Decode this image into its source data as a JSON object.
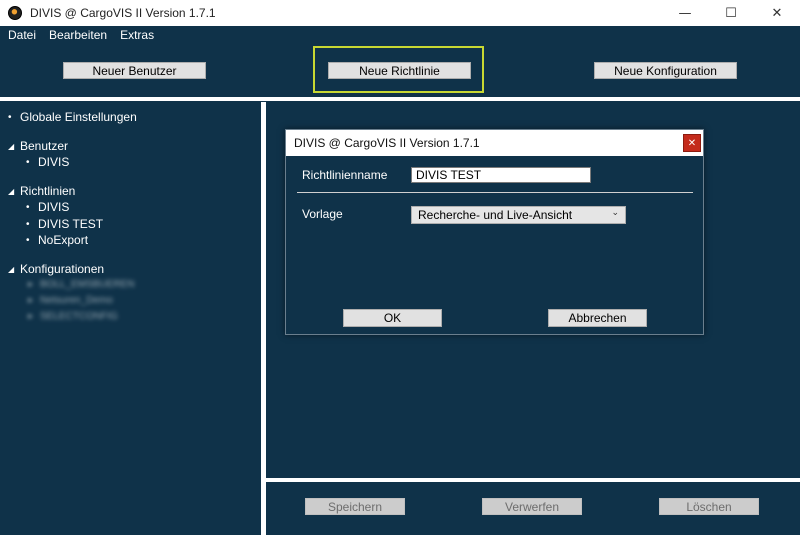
{
  "window": {
    "title": "DIVIS @ CargoVIS II Version 1.7.1",
    "minimize_glyph": "—",
    "maximize_glyph": "☐",
    "close_glyph": "✕"
  },
  "menu": {
    "items": [
      "Datei",
      "Bearbeiten",
      "Extras"
    ]
  },
  "toolbar": {
    "new_user": "Neuer Benutzer",
    "new_policy": "Neue Richtlinie",
    "new_config": "Neue Konfiguration"
  },
  "tree": {
    "global": "Globale Einstellungen",
    "users_header": "Benutzer",
    "users": [
      "DIVIS"
    ],
    "policies_header": "Richtlinien",
    "policies": [
      "DIVIS",
      "DIVIS TEST",
      "NoExport"
    ],
    "configs_header": "Konfigurationen",
    "configs": [
      "BOLL_EMSBUEREN",
      "Netsuren_Demo",
      "SELECTCONFIG"
    ]
  },
  "bottom_buttons": {
    "save": "Speichern",
    "discard": "Verwerfen",
    "delete": "Löschen"
  },
  "dialog": {
    "title": "DIVIS @ CargoVIS II Version 1.7.1",
    "close_glyph": "✕",
    "name_label": "Richtlinienname",
    "name_value": "DIVIS TEST",
    "template_label": "Vorlage",
    "template_value": "Recherche- und Live-Ansicht",
    "ok": "OK",
    "cancel": "Abbrechen"
  },
  "colors": {
    "background": "#0f3249",
    "highlight": "#c8d832",
    "close_red": "#c42b1c"
  }
}
